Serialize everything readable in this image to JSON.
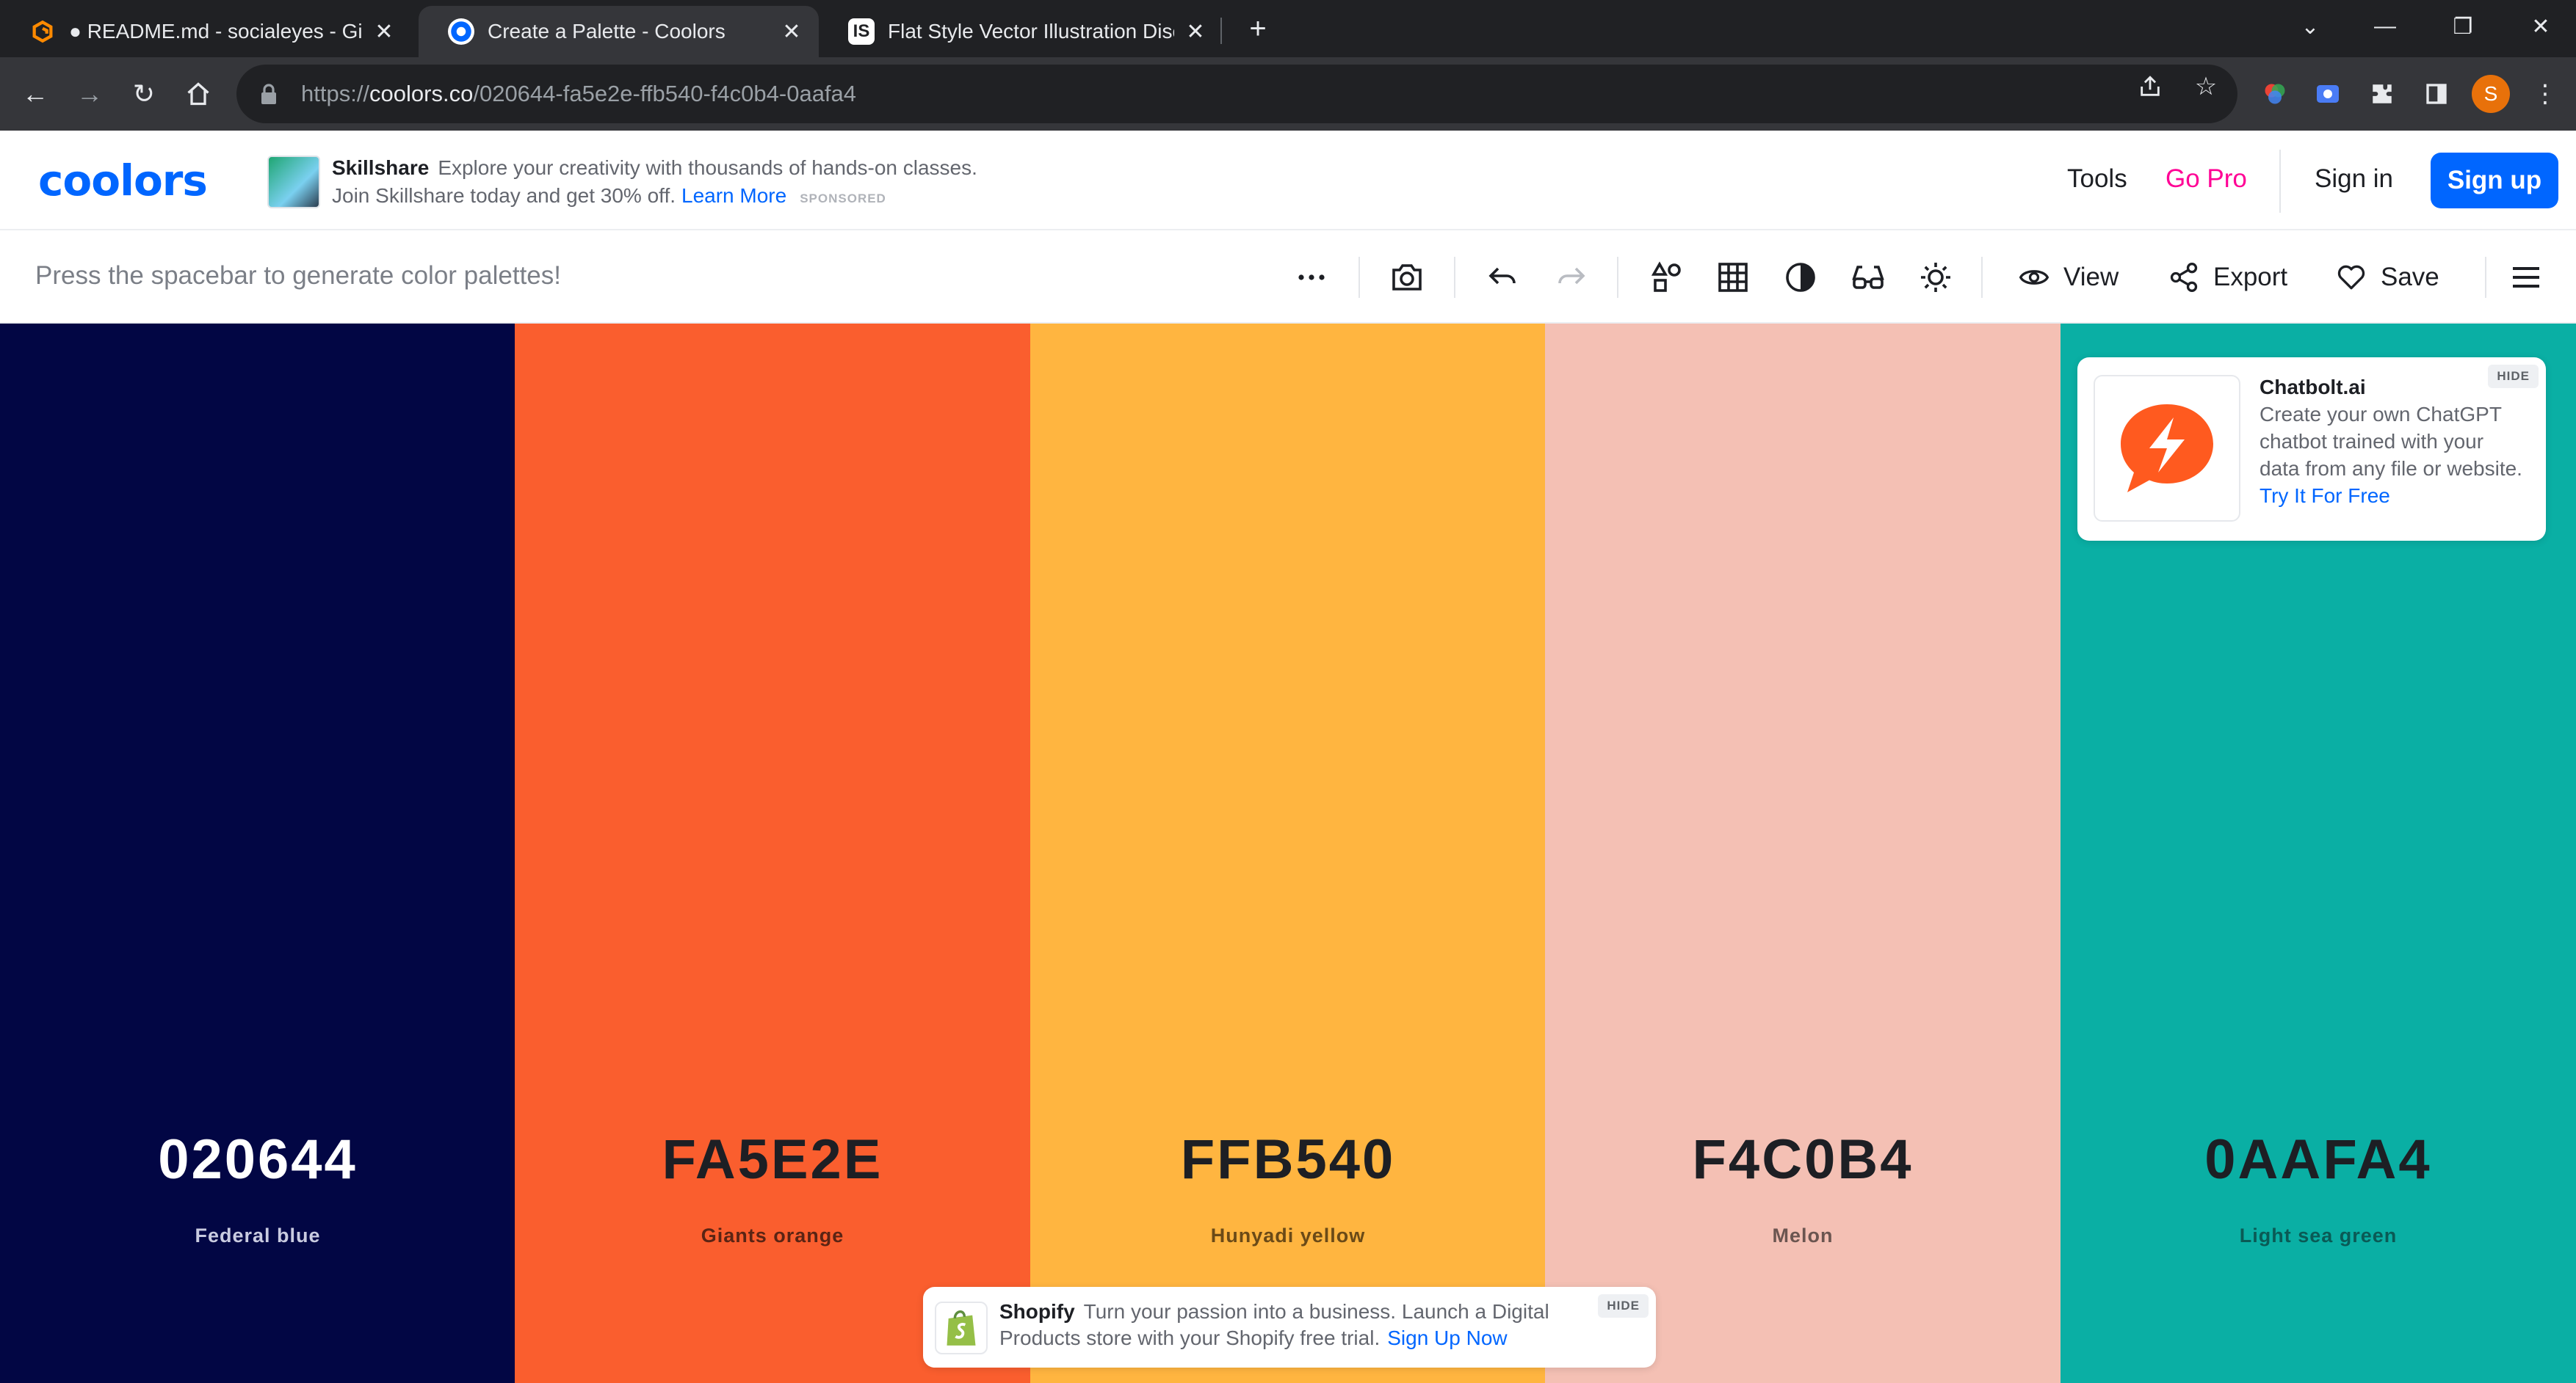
{
  "browser": {
    "tabs": [
      {
        "title": "● README.md - socialeyes - Gitp",
        "active": false,
        "icon": "gitpod-icon"
      },
      {
        "title": "Create a Palette - Coolors",
        "active": true,
        "icon": "coolors-icon"
      },
      {
        "title": "Flat Style Vector Illustration Disc",
        "active": false,
        "icon": "iconscout-icon"
      }
    ],
    "url_scheme": "https://",
    "url_host": "coolors.co",
    "url_path": "/020644-fa5e2e-ffb540-f4c0b4-0aafa4",
    "profile_initial": "S",
    "profile_color": "#e8710a"
  },
  "header": {
    "logo": "coolors",
    "ad": {
      "brand": "Skillshare",
      "text": "Explore your creativity with thousands of hands-on classes. Join Skillshare today and get 30% off.",
      "cta": "Learn More",
      "sponsored": "SPONSORED"
    },
    "nav": {
      "tools": "Tools",
      "go_pro": "Go Pro",
      "sign_in": "Sign in",
      "sign_up": "Sign up"
    }
  },
  "toolbar": {
    "hint": "Press the spacebar to generate color palettes!",
    "view": "View",
    "export": "Export",
    "save": "Save"
  },
  "palette": [
    {
      "hex": "020644",
      "name": "Federal blue",
      "color": "#020644",
      "text_color": "#ffffff",
      "name_color": "#c9cbe0"
    },
    {
      "hex": "FA5E2E",
      "name": "Giants orange",
      "color": "#fa5e2e",
      "text_color": "#1d1f24",
      "name_color": "#5a2414"
    },
    {
      "hex": "FFB540",
      "name": "Hunyadi yellow",
      "color": "#ffb540",
      "text_color": "#1d1f24",
      "name_color": "#6b4a17"
    },
    {
      "hex": "F4C0B4",
      "name": "Melon",
      "color": "#f4c0b4",
      "text_color": "#1d1f24",
      "name_color": "#6b5550"
    },
    {
      "hex": "0AAFA4",
      "name": "Light sea green",
      "color": "#0aafa4",
      "text_color": "#1d1f24",
      "name_color": "#0a5a55"
    }
  ],
  "ads": {
    "chatbolt": {
      "brand": "Chatbolt.ai",
      "text": "Create your own ChatGPT chatbot trained with your data from any file or website.",
      "cta": "Try It For Free",
      "hide": "HIDE",
      "logo_color": "#ff5a1f"
    },
    "shopify": {
      "brand": "Shopify",
      "text": "Turn your passion into a business. Launch a Digital Products store with your Shopify free trial.",
      "cta": "Sign Up Now",
      "hide": "HIDE",
      "logo_color": "#95bf47"
    }
  }
}
